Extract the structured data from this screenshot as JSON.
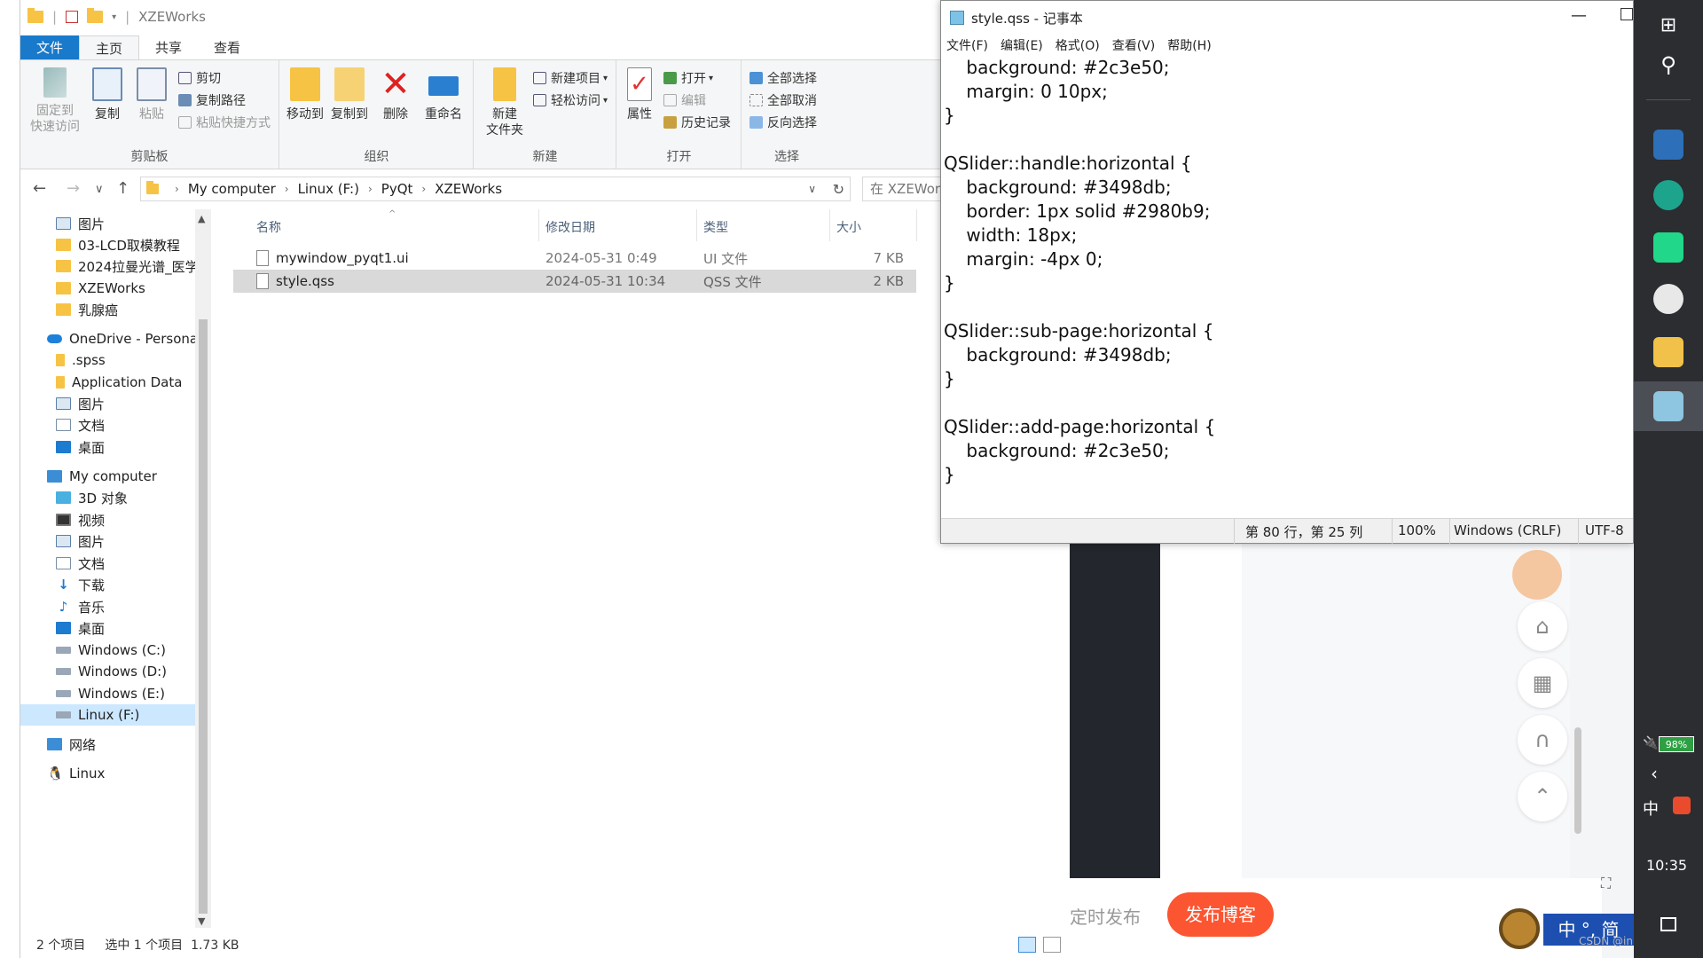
{
  "explorer": {
    "title": "XZEWorks",
    "tabs": [
      "文件",
      "主页",
      "共享",
      "查看"
    ],
    "ribbon": {
      "clipboard": {
        "label": "剪贴板",
        "pin": "固定到\n快速访问",
        "pin_l1": "固定到",
        "pin_l2": "快速访问",
        "copy": "复制",
        "paste": "粘贴",
        "cut": "剪切",
        "copy_path": "复制路径",
        "paste_shortcut": "粘贴快捷方式"
      },
      "organize": {
        "label": "组织",
        "move_to": "移动到",
        "copy_to": "复制到",
        "delete": "删除",
        "rename": "重命名"
      },
      "new": {
        "label": "新建",
        "new_folder_l1": "新建",
        "new_folder_l2": "文件夹",
        "new_item": "新建项目",
        "easy_access": "轻松访问"
      },
      "open": {
        "label": "打开",
        "properties": "属性",
        "open": "打开",
        "edit": "编辑",
        "history": "历史记录"
      },
      "select": {
        "label": "选择",
        "select_all": "全部选择",
        "select_none": "全部取消",
        "invert": "反向选择"
      }
    },
    "address": [
      "My computer",
      "Linux (F:)",
      "PyQt",
      "XZEWorks"
    ],
    "search_placeholder": "在 XZEWorks",
    "nav": [
      {
        "label": "图片",
        "icon": "pictures-icon"
      },
      {
        "label": "03-LCD取模教程",
        "icon": "folder-icon"
      },
      {
        "label": "2024拉曼光谱_医学",
        "icon": "folder-icon"
      },
      {
        "label": "XZEWorks",
        "icon": "folder-icon"
      },
      {
        "label": "乳腺癌",
        "icon": "folder-icon"
      },
      {
        "label": "OneDrive - Persona",
        "icon": "onedrive-icon"
      },
      {
        "label": ".spss",
        "icon": "folder-icon"
      },
      {
        "label": "Application Data",
        "icon": "folder-icon"
      },
      {
        "label": "图片",
        "icon": "pictures-icon"
      },
      {
        "label": "文档",
        "icon": "documents-icon"
      },
      {
        "label": "桌面",
        "icon": "desktop-icon"
      },
      {
        "label": "My computer",
        "icon": "computer-icon"
      },
      {
        "label": "3D 对象",
        "icon": "3d-objects-icon"
      },
      {
        "label": "视频",
        "icon": "videos-icon"
      },
      {
        "label": "图片",
        "icon": "pictures-icon"
      },
      {
        "label": "文档",
        "icon": "documents-icon"
      },
      {
        "label": "下载",
        "icon": "downloads-icon"
      },
      {
        "label": "音乐",
        "icon": "music-icon"
      },
      {
        "label": "桌面",
        "icon": "desktop-icon"
      },
      {
        "label": "Windows (C:)",
        "icon": "drive-icon"
      },
      {
        "label": "Windows (D:)",
        "icon": "drive-icon"
      },
      {
        "label": "Windows (E:)",
        "icon": "drive-icon"
      },
      {
        "label": "Linux (F:)",
        "icon": "drive-icon"
      },
      {
        "label": "网络",
        "icon": "network-icon"
      },
      {
        "label": "Linux",
        "icon": "linux-icon"
      }
    ],
    "columns": [
      "名称",
      "修改日期",
      "类型",
      "大小"
    ],
    "files": [
      {
        "name": "mywindow_pyqt1.ui",
        "date": "2024-05-31 0:49",
        "type": "UI 文件",
        "size": "7 KB"
      },
      {
        "name": "style.qss",
        "date": "2024-05-31 10:34",
        "type": "QSS 文件",
        "size": "2 KB"
      }
    ],
    "status": {
      "count": "2 个项目",
      "selected": "选中 1 个项目  1.73 KB"
    }
  },
  "notepad": {
    "title": "style.qss - 记事本",
    "menu": [
      "文件(F)",
      "编辑(E)",
      "格式(O)",
      "查看(V)",
      "帮助(H)"
    ],
    "content": "    background: #2c3e50;\n    margin: 0 10px;\n}\n\nQSlider::handle:horizontal {\n    background: #3498db;\n    border: 1px solid #2980b9;\n    width: 18px;\n    margin: -4px 0;\n}\n\nQSlider::sub-page:horizontal {\n    background: #3498db;\n}\n\nQSlider::add-page:horizontal {\n    background: #2c3e50;\n}",
    "status": {
      "position": "第 80 行，第 25 列",
      "zoom": "100%",
      "eol": "Windows (CRLF)",
      "encoding": "UTF-8"
    }
  },
  "browser": {
    "schedule": "定时发布",
    "publish": "发布博客",
    "watermark": "CSDN @innerddboy"
  },
  "taskbar": {
    "battery": "98%",
    "ime": "中",
    "time": "10:35",
    "ime_bar": "中 °, 简"
  },
  "colors": {
    "ribbon_file_tab": "#1979ca",
    "selection": "#cce8ff",
    "publish_button": "#fc5531",
    "taskbar": "#2b2d31"
  }
}
